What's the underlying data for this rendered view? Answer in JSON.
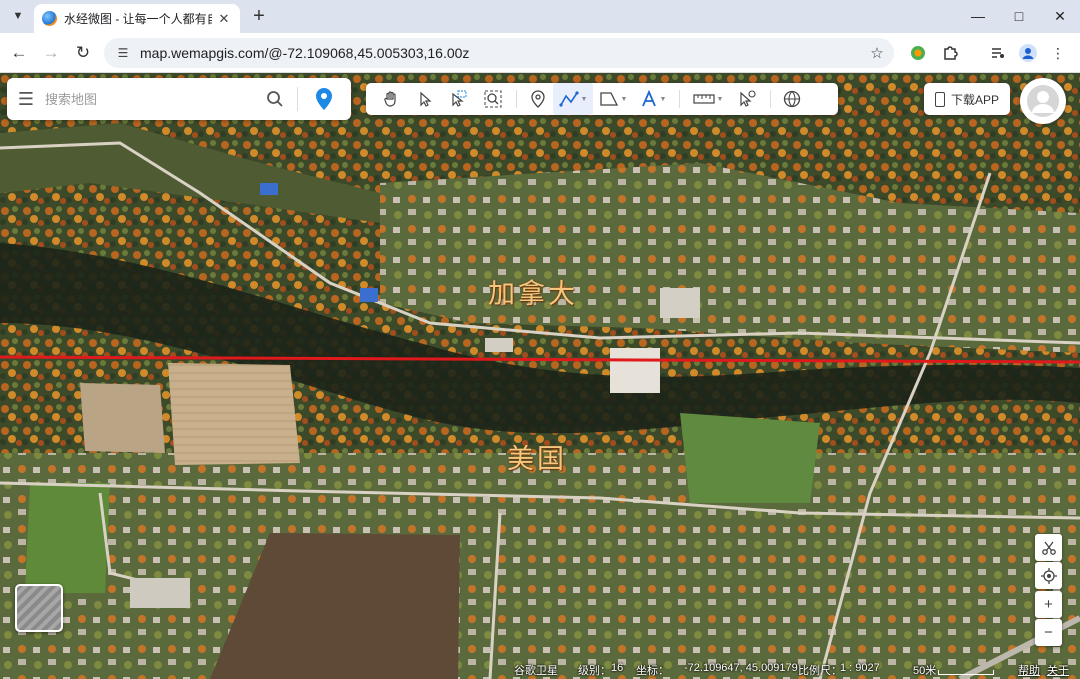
{
  "browser": {
    "tab_title": "水经微图 - 让每一个人都有自己",
    "url": "map.wemapgis.com/@-72.109068,45.005303,16.00z"
  },
  "search": {
    "placeholder": "搜索地图"
  },
  "toolbar": {
    "items": [
      "hand-pan",
      "select-pointer",
      "select-box",
      "zoom-box",
      "marker",
      "polyline",
      "polygon",
      "text",
      "measure",
      "identify",
      "globe"
    ]
  },
  "download_app": "下载APP",
  "map_labels": {
    "canada": "加拿大",
    "usa": "美国"
  },
  "status": {
    "source": "谷歌卫星",
    "level_label": "级别：",
    "level": "16",
    "coord_label": "坐标：",
    "coord": "-72.109647, 45.009179",
    "scale_label": "比例尺：",
    "scale": "1 : 9027",
    "scale_bar": "50米",
    "help": "帮助",
    "about": "关于"
  },
  "colors": {
    "border_line": "#e0191c",
    "label_text": "#f5c77e",
    "pin": "#1e88e5"
  }
}
